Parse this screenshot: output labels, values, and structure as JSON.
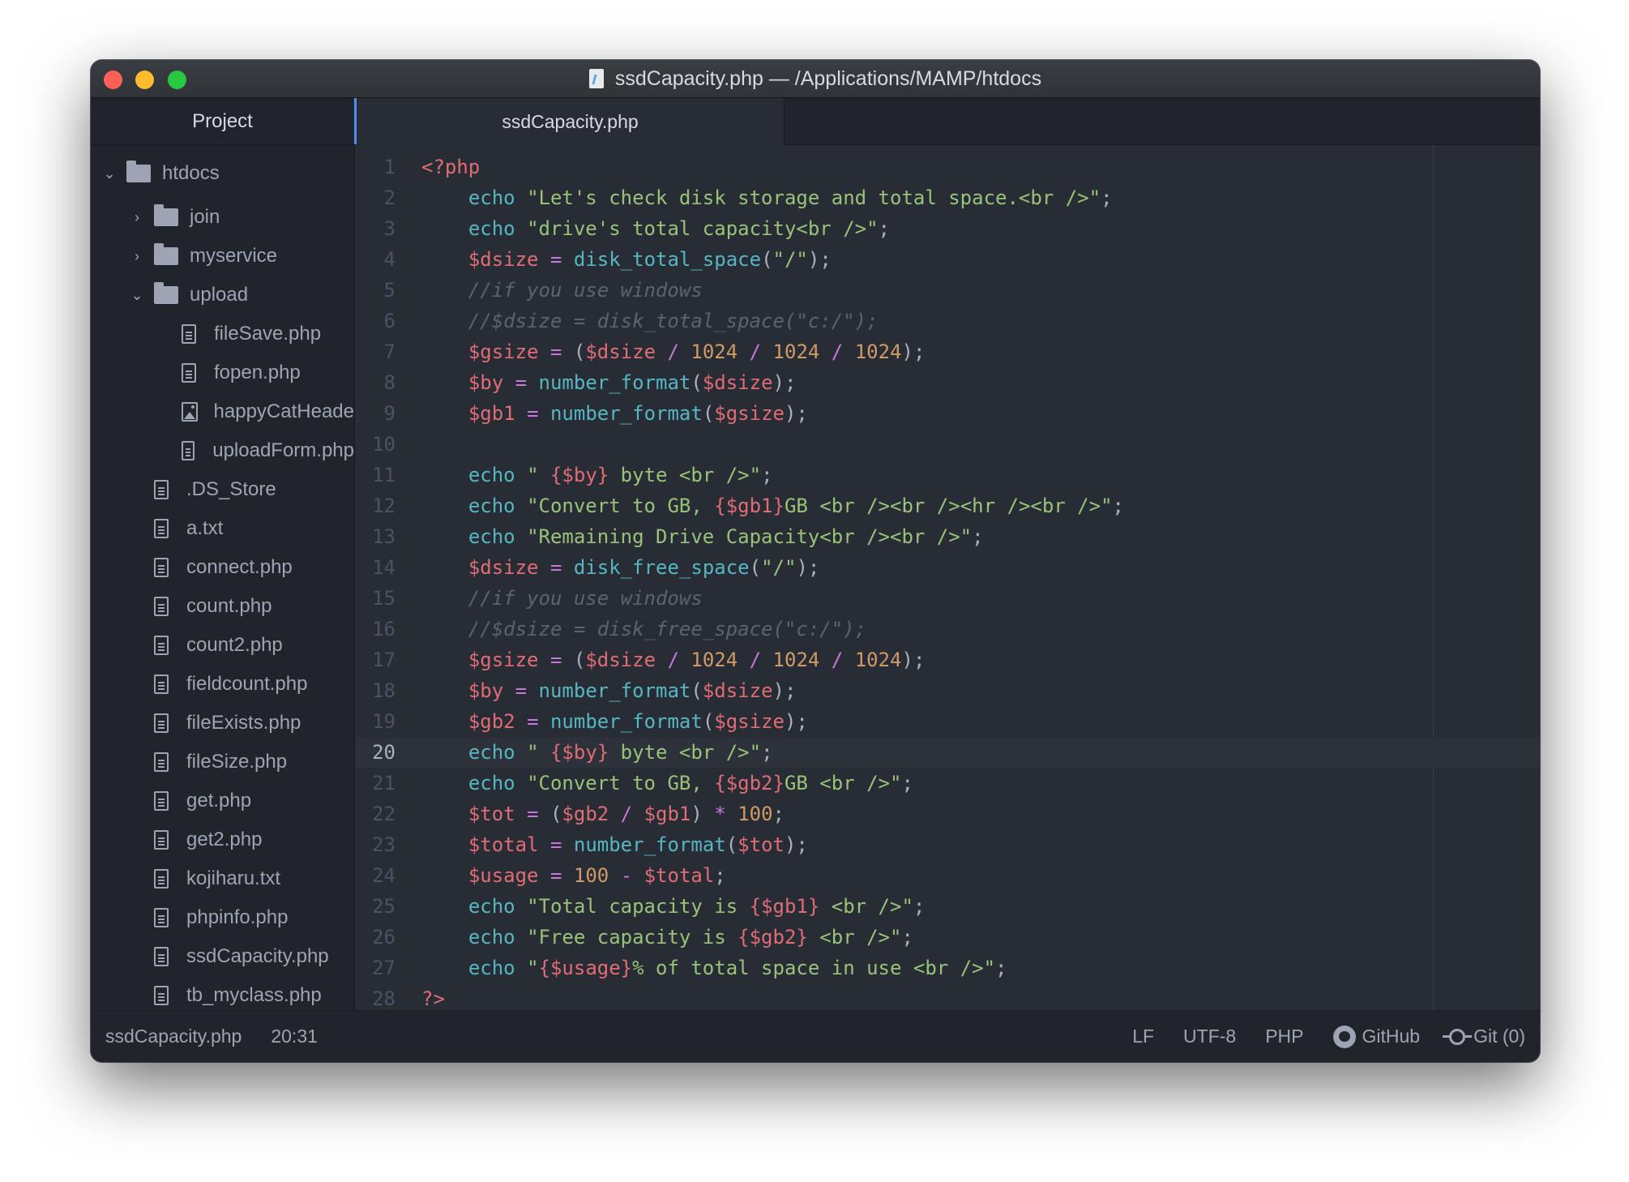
{
  "window": {
    "title": "ssdCapacity.php — /Applications/MAMP/htdocs"
  },
  "sidebar": {
    "header": "Project",
    "root": "htdocs",
    "folders": [
      "join",
      "myservice",
      "upload"
    ],
    "upload_files": [
      "fileSave.php",
      "fopen.php",
      "happyCatHeade",
      "uploadForm.php"
    ],
    "files": [
      ".DS_Store",
      "a.txt",
      "connect.php",
      "count.php",
      "count2.php",
      "fieldcount.php",
      "fileExists.php",
      "fileSize.php",
      "get.php",
      "get2.php",
      "kojiharu.txt",
      "phpinfo.php",
      "ssdCapacity.php",
      "tb_myclass.php"
    ]
  },
  "tabs": [
    {
      "label": "ssdCapacity.php",
      "active": true
    }
  ],
  "editor": {
    "current_line": 20,
    "line_numbers": [
      "1",
      "2",
      "3",
      "4",
      "5",
      "6",
      "7",
      "8",
      "9",
      "10",
      "11",
      "12",
      "13",
      "14",
      "15",
      "16",
      "17",
      "18",
      "19",
      "20",
      "21",
      "22",
      "23",
      "24",
      "25",
      "26",
      "27",
      "28"
    ],
    "lines": [
      "<?php",
      "    echo \"Let's check disk storage and total space.<br />\";",
      "    echo \"drive's total capacity<br />\";",
      "    $dsize = disk_total_space(\"/\");",
      "    //if you use windows",
      "    //$dsize = disk_total_space(\"c:/\");",
      "    $gsize = ($dsize / 1024 / 1024 / 1024);",
      "    $by = number_format($dsize);",
      "    $gb1 = number_format($gsize);",
      "",
      "    echo \" {$by} byte <br />\";",
      "    echo \"Convert to GB, {$gb1}GB <br /><br /><hr /><br />\";",
      "    echo \"Remaining Drive Capacity<br /><br />\";",
      "    $dsize = disk_free_space(\"/\");",
      "    //if you use windows",
      "    //$dsize = disk_free_space(\"c:/\");",
      "    $gsize = ($dsize / 1024 / 1024 / 1024);",
      "    $by = number_format($dsize);",
      "    $gb2 = number_format($gsize);",
      "    echo \" {$by} byte <br />\";",
      "    echo \"Convert to GB, {$gb2}GB <br />\";",
      "    $tot = ($gb2 / $gb1) * 100;",
      "    $total = number_format($tot);",
      "    $usage = 100 - $total;",
      "    echo \"Total capacity is {$gb1} <br />\";",
      "    echo \"Free capacity is {$gb2} <br />\";",
      "    echo \"{$usage}% of total space in use <br />\";",
      "?>"
    ]
  },
  "statusbar": {
    "file": "ssdCapacity.php",
    "cursor": "20:31",
    "line_ending": "LF",
    "encoding": "UTF-8",
    "grammar": "PHP",
    "github": "GitHub",
    "git": "Git (0)"
  },
  "colors": {
    "background": "#282c34",
    "sidebar": "#21252b",
    "keyword": "#c678dd",
    "function": "#56b6c2",
    "variable": "#e06c75",
    "string": "#98c379",
    "number": "#d19a66",
    "comment": "#5c6370",
    "accent": "#568af2"
  }
}
